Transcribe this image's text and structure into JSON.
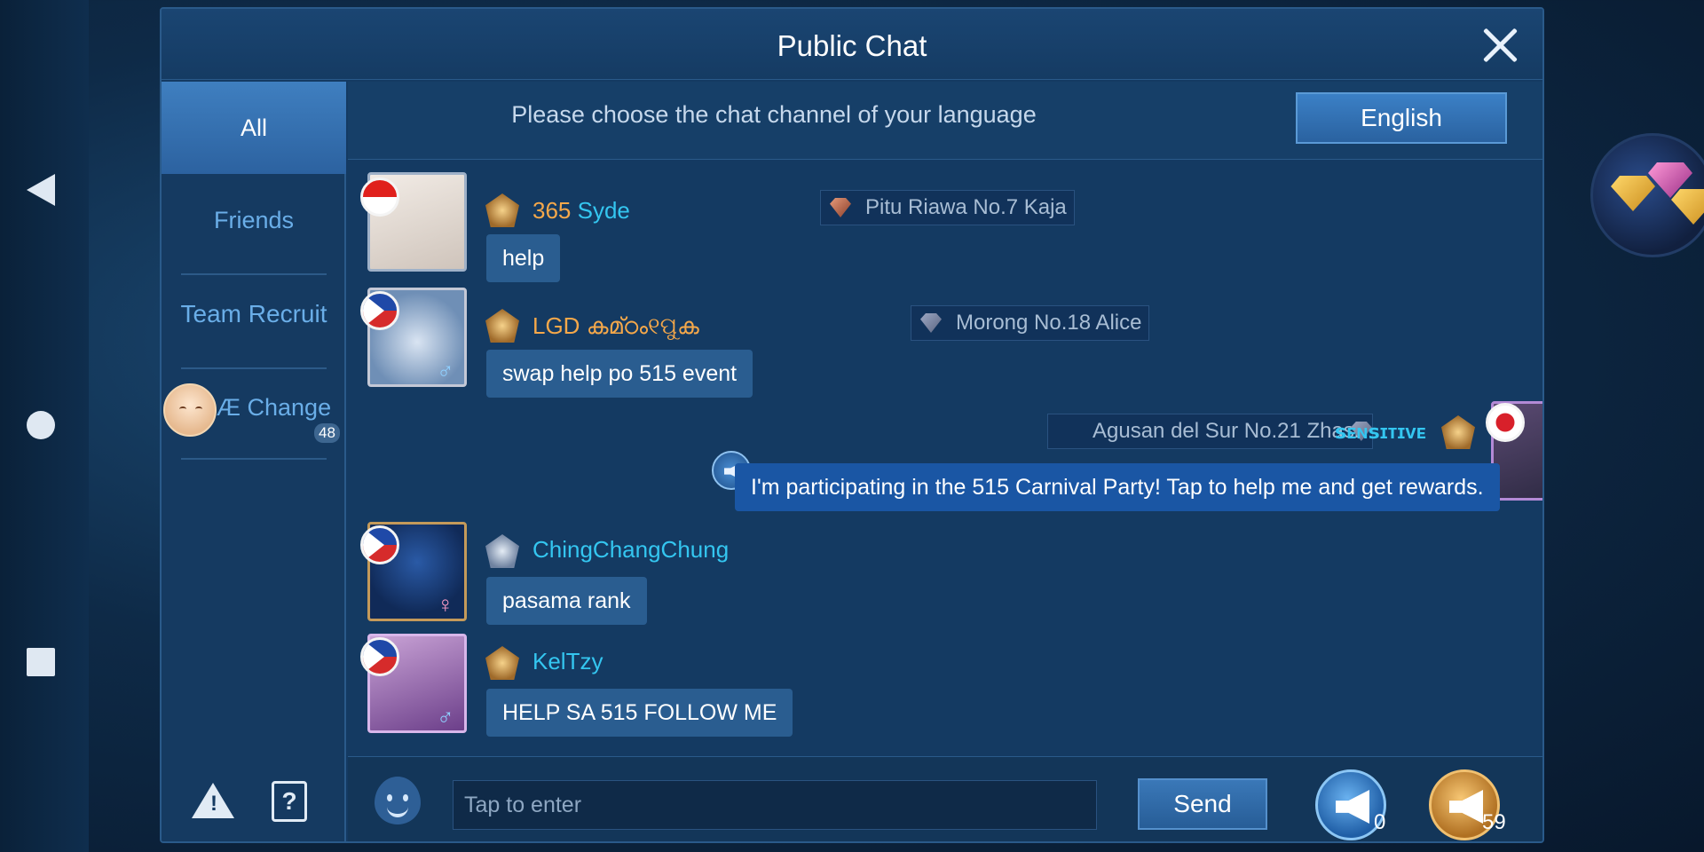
{
  "window": {
    "title": "Public Chat"
  },
  "sidebar": {
    "tabs": [
      {
        "label": "All",
        "active": true
      },
      {
        "label": "Friends",
        "active": false
      },
      {
        "label": "Team Recruit",
        "active": false
      }
    ],
    "change": {
      "label": "Æ Change",
      "count": "48"
    }
  },
  "language_bar": {
    "prompt": "Please choose the chat channel of your language",
    "button": "English"
  },
  "messages": [
    {
      "clan": "365",
      "user": "Syde",
      "location": "Pitu Riawa No.7 Kaja",
      "text": "help",
      "flag": "Indonesia",
      "side": "left"
    },
    {
      "clan": "LGD",
      "user": "കമ്ഠം୧ପୁക",
      "location": "Morong No.18 Alice",
      "text": "swap help po 515 event",
      "flag": "Philippines",
      "side": "left",
      "gender": "♂"
    },
    {
      "clan": "",
      "user": "ꜱᴇɴꜱɪᴛɪᴠᴇ",
      "location": "Agusan del Sur No.21 Zhask",
      "text": "I'm participating in the 515 Carnival Party! Tap to help me and get rewards.",
      "flag": "Japan",
      "side": "right",
      "gender": "♂"
    },
    {
      "clan": "",
      "user": "ChingChangChung",
      "location": "",
      "text": "pasama rank",
      "flag": "Philippines",
      "side": "left",
      "gender": "♀"
    },
    {
      "clan": "",
      "user": "KelTzy",
      "location": "",
      "text": "HELP SA 515 FOLLOW ME",
      "flag": "Philippines",
      "side": "left",
      "gender": "♂"
    }
  ],
  "input": {
    "placeholder": "Tap to enter",
    "value": ""
  },
  "send_button": "Send",
  "horns": {
    "blue_count": "0",
    "gold_count": "59"
  },
  "icons": [
    "back-icon",
    "home-icon",
    "recents-icon",
    "close-icon",
    "warning-icon",
    "help-book-icon",
    "emoji-icon",
    "horn-icon"
  ]
}
